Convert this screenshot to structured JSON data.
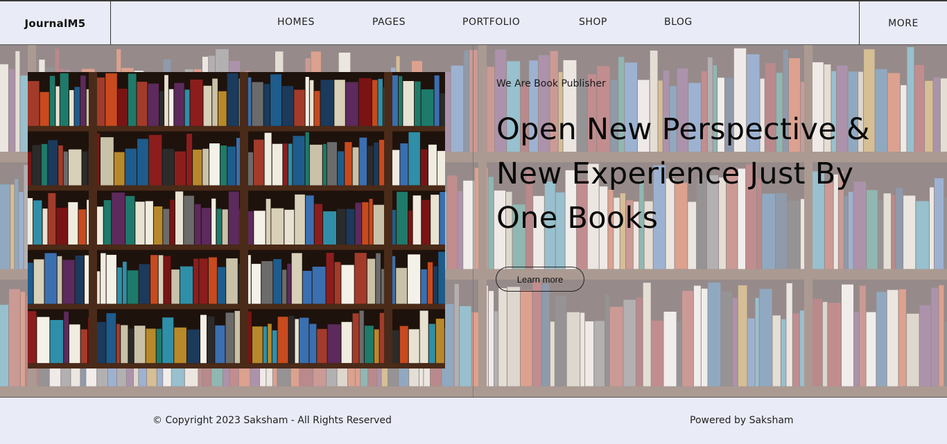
{
  "header": {
    "brand": "JournalM5",
    "nav": [
      {
        "label": "HOMES"
      },
      {
        "label": "PAGES"
      },
      {
        "label": "PORTFOLIO"
      },
      {
        "label": "SHOP"
      },
      {
        "label": "BLOG"
      }
    ],
    "more": "MORE"
  },
  "hero": {
    "eyebrow": "We Are Book Publisher",
    "headline_lines": [
      "Open New Perspective &",
      "New Experience Just By",
      "One Books"
    ],
    "cta_label": "Learn more",
    "photo_icon": "bookshelf-photo"
  },
  "footer": {
    "copyright": "© Copyright 2023 Saksham - All Rights Reserved",
    "powered": "Powered by Saksham"
  },
  "colors": {
    "page_bg": "#e9ebf7",
    "shelf_wood": "#4a2a18",
    "text": "#0a0a0a"
  }
}
